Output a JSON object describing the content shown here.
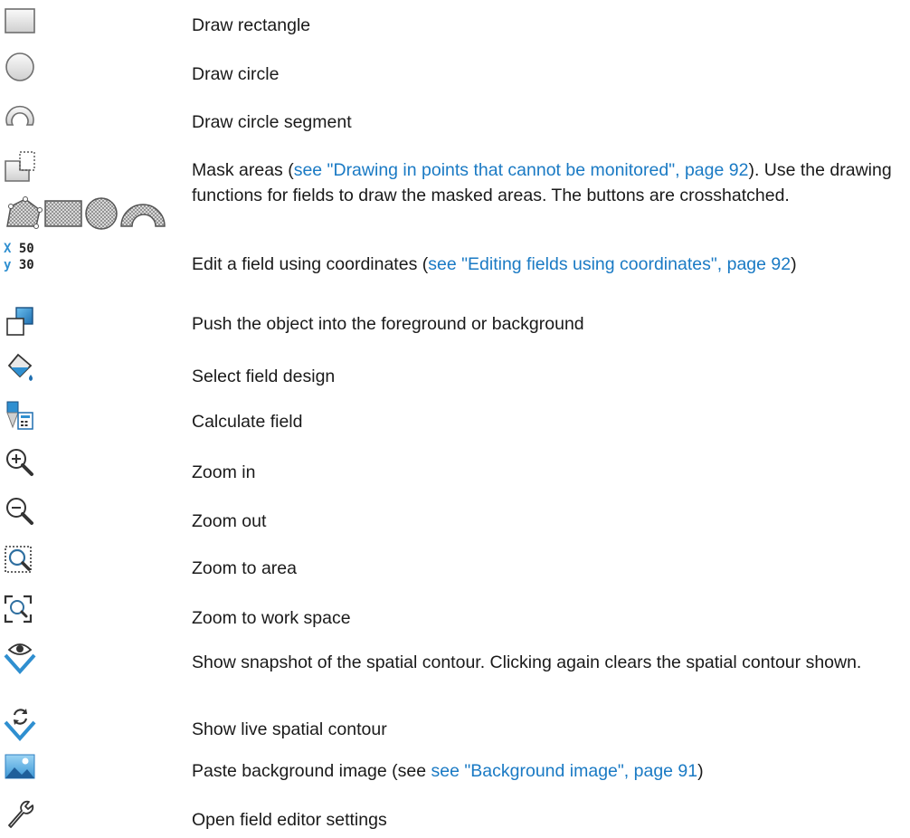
{
  "rows": [
    {
      "icon": "rectangle-icon",
      "text": "Draw rectangle"
    },
    {
      "icon": "circle-icon",
      "text": "Draw circle"
    },
    {
      "icon": "circle-segment-icon",
      "text": "Draw circle segment"
    },
    {
      "icon": "mask-areas-icon",
      "text_before": "Mask areas (",
      "link": "see \"Drawing in points that cannot be monitored\", page 92",
      "text_after": "). Use the drawing functions for fields to draw the masked areas. The buttons are crosshatched."
    },
    {
      "icon": "coordinates-icon",
      "icon_label_x": "x 50",
      "icon_label_y": "y 30",
      "text_before": "Edit a field using coordinates (",
      "link": "see \"Editing fields using coordinates\", page 92",
      "text_after": ")"
    },
    {
      "icon": "bring-to-front-icon",
      "text": "Push the object into the foreground or background"
    },
    {
      "icon": "paint-bucket-icon",
      "text": "Select field design"
    },
    {
      "icon": "calculator-icon",
      "text": "Calculate field"
    },
    {
      "icon": "zoom-in-icon",
      "text": "Zoom in"
    },
    {
      "icon": "zoom-out-icon",
      "text": "Zoom out"
    },
    {
      "icon": "zoom-area-icon",
      "text": "Zoom to area"
    },
    {
      "icon": "zoom-workspace-icon",
      "text": "Zoom to work space"
    },
    {
      "icon": "eye-contour-icon",
      "text": "Show snapshot of the spatial contour. Clicking again clears the spatial contour shown."
    },
    {
      "icon": "live-contour-icon",
      "text": "Show live spatial contour"
    },
    {
      "icon": "image-icon",
      "text_before": "Paste background image (see ",
      "link": "see \"Background image\", page 91",
      "text_after": ")"
    },
    {
      "icon": "wrench-icon",
      "text": "Open field editor settings"
    }
  ],
  "colors": {
    "link": "#1a7ac4",
    "text": "#1a1a1a",
    "icon_blue": "#2f8fd0"
  }
}
